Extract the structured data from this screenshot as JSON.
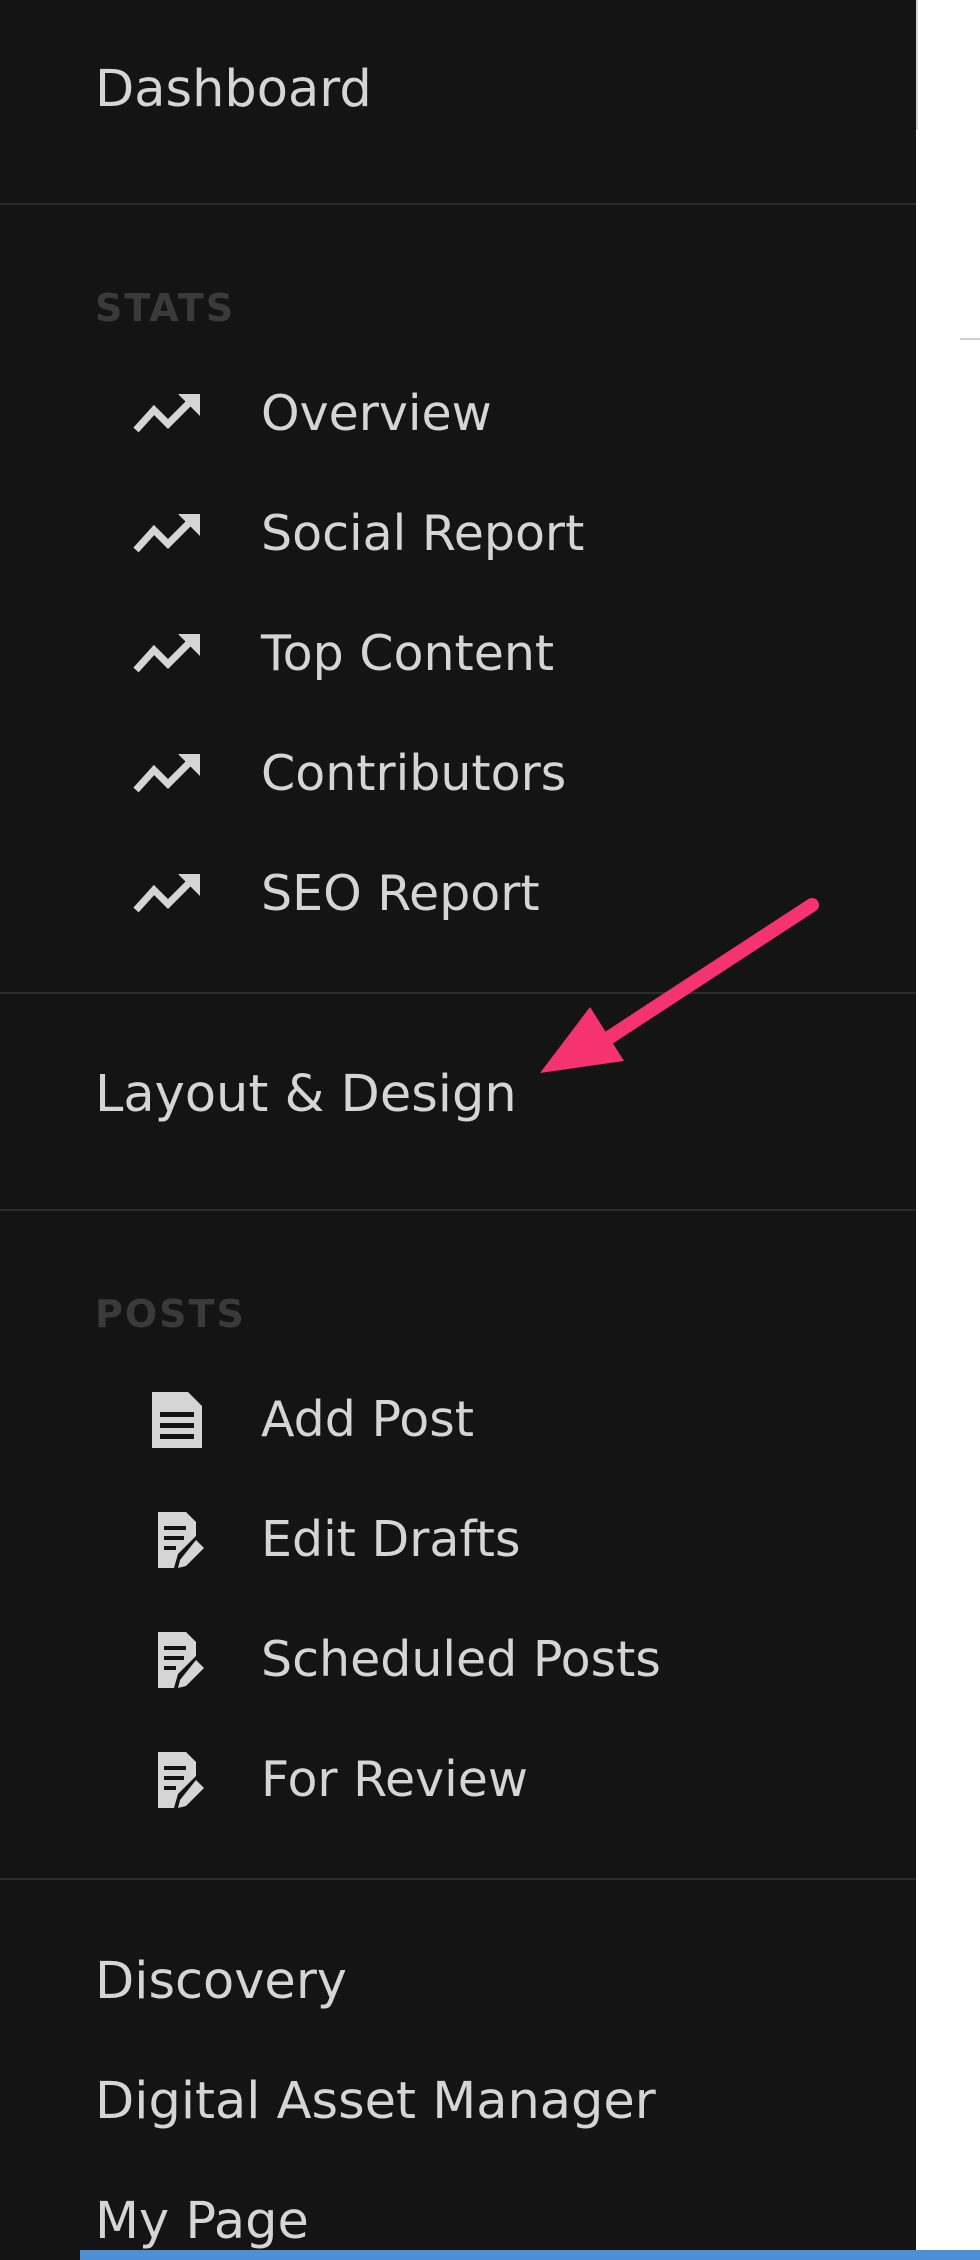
{
  "sidebar": {
    "dashboard": "Dashboard",
    "stats_heading": "STATS",
    "stats_items": [
      {
        "label": "Overview",
        "icon": "trending-up-icon"
      },
      {
        "label": "Social Report",
        "icon": "trending-up-icon"
      },
      {
        "label": "Top Content",
        "icon": "trending-up-icon"
      },
      {
        "label": "Contributors",
        "icon": "trending-up-icon"
      },
      {
        "label": "SEO Report",
        "icon": "trending-up-icon"
      }
    ],
    "layout_design": "Layout & Design",
    "posts_heading": "POSTS",
    "posts_items": [
      {
        "label": "Add Post",
        "icon": "document-icon"
      },
      {
        "label": "Edit Drafts",
        "icon": "edit-document-icon"
      },
      {
        "label": "Scheduled Posts",
        "icon": "edit-document-icon"
      },
      {
        "label": "For Review",
        "icon": "edit-document-icon"
      }
    ],
    "discovery": "Discovery",
    "digital_asset_manager": "Digital Asset Manager",
    "my_page": "My Page"
  },
  "annotation": {
    "arrow_color": "#f5336e"
  },
  "colors": {
    "sidebar_bg": "#141414",
    "text": "#d5d5d5",
    "heading_text": "#3a3a3a",
    "divider": "#2b2b2b",
    "accent_bar": "#4d8fd6"
  }
}
